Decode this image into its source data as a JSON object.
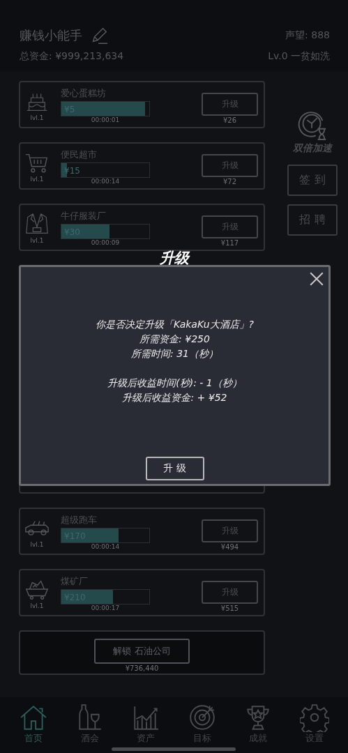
{
  "header": {
    "player_name": "赚钱小能手",
    "total_funds": "总资金: ¥999,213,634",
    "reputation": "声望: 888",
    "rank": "Lv.0 一贫如洗"
  },
  "businesses_top": [
    {
      "name": "爱心蛋糕坊",
      "income": "¥5",
      "level": 0.95,
      "time": "00:00:01",
      "lvl": "lvl.1",
      "button": "升级",
      "cost": "¥26"
    },
    {
      "name": "便民超市",
      "income": "¥15",
      "level": 0.06,
      "time": "00:00:14",
      "lvl": "lvl.1",
      "button": "升级",
      "cost": "¥72"
    },
    {
      "name": "牛仔服装厂",
      "income": "¥30",
      "level": 0.55,
      "time": "00:00:09",
      "lvl": "lvl.1",
      "button": "升级",
      "cost": "¥117"
    }
  ],
  "businesses_bottom": [
    {
      "name": "超级跑车",
      "income": "¥170",
      "level": 0.65,
      "time": "00:00:14",
      "lvl": "lvl.1",
      "button": "升级",
      "cost": "¥494"
    },
    {
      "name": "煤矿厂",
      "income": "¥210",
      "level": 0.59,
      "time": "00:00:17",
      "lvl": "lvl.1",
      "button": "升级",
      "cost": "¥515"
    }
  ],
  "unlock": {
    "button": "解锁 石油公司",
    "cost": "¥736,440"
  },
  "side": {
    "boost": "双倍加速",
    "buttons": [
      "签 到",
      "招 聘"
    ]
  },
  "dialog": {
    "title": "升级",
    "lines": [
      "你是否决定升级「KakaKu大酒店」?",
      "所需资金: ¥250",
      "所需时间: 31（秒）"
    ],
    "result_lines": [
      "升级后收益时间(秒): - 1（秒）",
      "升级后收益资金: + ¥52"
    ],
    "button": "升 级"
  },
  "tabs": [
    {
      "label": "首页",
      "selected": true
    },
    {
      "label": "酒会",
      "selected": false
    },
    {
      "label": "资产",
      "selected": false
    },
    {
      "label": "目标",
      "selected": false
    },
    {
      "label": "成就",
      "selected": false
    },
    {
      "label": "设置",
      "selected": false
    }
  ]
}
